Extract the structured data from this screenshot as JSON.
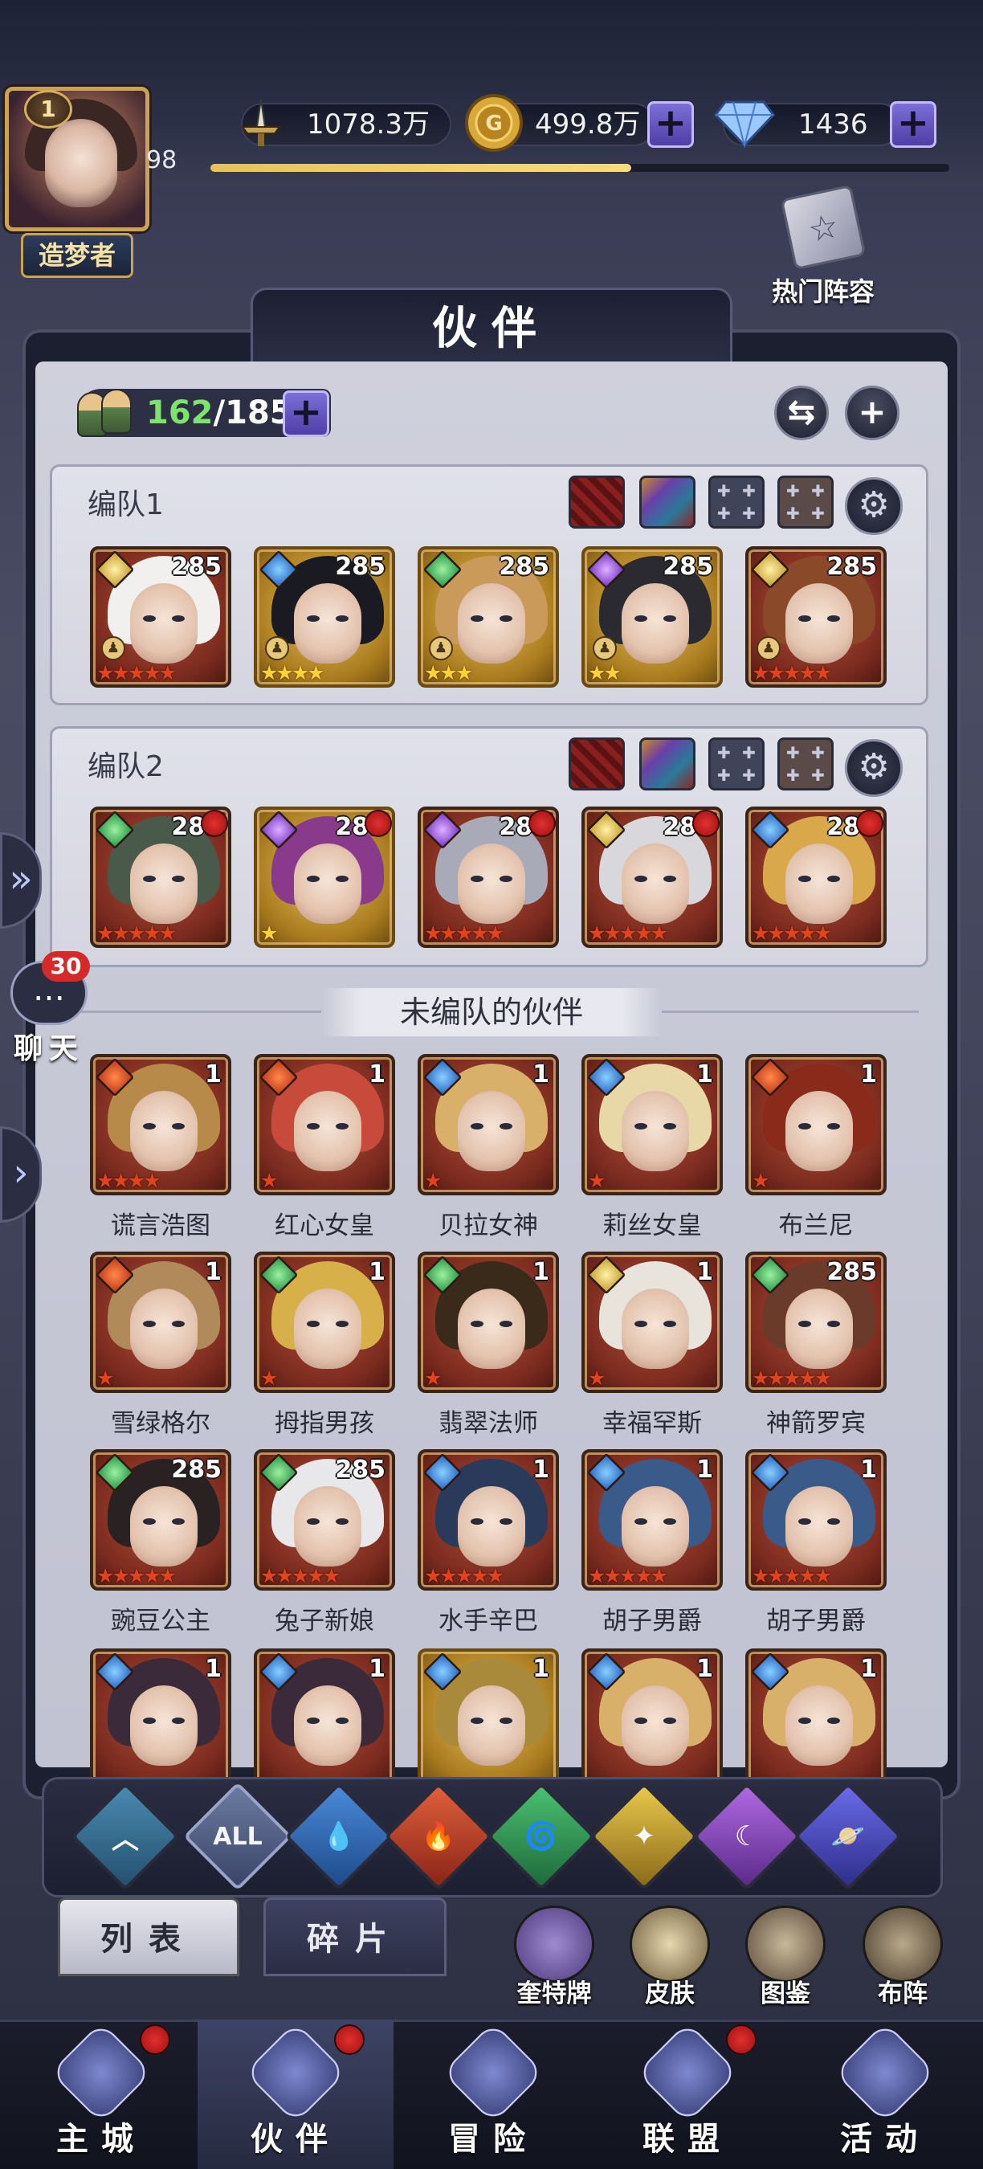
{
  "player": {
    "level": "1",
    "sub_level": "98",
    "title": "造梦者",
    "exp_fraction": 0.57
  },
  "resources": {
    "power": "1078.3万",
    "gold": "499.8万",
    "diamonds": "1436"
  },
  "hot_lineup_label": "热门阵容",
  "page_title": "伙伴",
  "partner_count": {
    "current": "162",
    "max": "/185"
  },
  "squads": [
    {
      "name": "编队1",
      "heroes": [
        {
          "level": "285",
          "element": "light",
          "bg": "red",
          "stars": "★★★★★",
          "star_color": "red",
          "hair": "#f2f0ee",
          "pawn": true,
          "dot": false
        },
        {
          "level": "285",
          "element": "water",
          "bg": "gold",
          "stars": "★★★★",
          "star_color": "gold",
          "hair": "#1a1a22",
          "pawn": true,
          "dot": false
        },
        {
          "level": "285",
          "element": "wind",
          "bg": "gold",
          "stars": "★★★",
          "star_color": "gold",
          "hair": "#c99a5a",
          "pawn": true,
          "dot": false
        },
        {
          "level": "285",
          "element": "dark",
          "bg": "gold",
          "stars": "★★",
          "star_color": "gold",
          "hair": "#2a2a30",
          "pawn": true,
          "dot": false
        },
        {
          "level": "285",
          "element": "light",
          "bg": "red",
          "stars": "★★★★★",
          "star_color": "red",
          "hair": "#8a4a2a",
          "pawn": true,
          "dot": false
        }
      ]
    },
    {
      "name": "编队2",
      "heroes": [
        {
          "level": "285",
          "element": "wind",
          "bg": "red",
          "stars": "★★★★★",
          "star_color": "red",
          "hair": "#4a5a4a",
          "pawn": false,
          "dot": true
        },
        {
          "level": "285",
          "element": "dark",
          "bg": "gold",
          "stars": "★",
          "star_color": "gold",
          "hair": "#8a3a8a",
          "pawn": false,
          "dot": true
        },
        {
          "level": "285",
          "element": "dark",
          "bg": "red",
          "stars": "★★★★★",
          "star_color": "red",
          "hair": "#a8aab8",
          "pawn": false,
          "dot": true
        },
        {
          "level": "285",
          "element": "light",
          "bg": "red",
          "stars": "★★★★★",
          "star_color": "red",
          "hair": "#d8d8dc",
          "pawn": false,
          "dot": true
        },
        {
          "level": "285",
          "element": "water",
          "bg": "red",
          "stars": "★★★★★",
          "star_color": "red",
          "hair": "#d8a84a",
          "pawn": false,
          "dot": true
        }
      ]
    }
  ],
  "unassigned_label": "未编队的伙伴",
  "unassigned": [
    {
      "name": "谎言浩图",
      "level": "1",
      "element": "fire",
      "stars": "★★★★",
      "hair": "#b88a4a"
    },
    {
      "name": "红心女皇",
      "level": "1",
      "element": "fire",
      "stars": "★",
      "hair": "#c84a3a"
    },
    {
      "name": "贝拉女神",
      "level": "1",
      "element": "water",
      "stars": "★",
      "hair": "#d8b06a"
    },
    {
      "name": "莉丝女皇",
      "level": "1",
      "element": "water",
      "stars": "★",
      "hair": "#e8d8a8"
    },
    {
      "name": "布兰尼",
      "level": "1",
      "element": "fire",
      "stars": "★",
      "hair": "#8a2a1a"
    },
    {
      "name": "雪绿格尔",
      "level": "1",
      "element": "fire",
      "stars": "★",
      "hair": "#b08a5a"
    },
    {
      "name": "拇指男孩",
      "level": "1",
      "element": "wind",
      "stars": "★",
      "hair": "#d8b04a"
    },
    {
      "name": "翡翠法师",
      "level": "1",
      "element": "wind",
      "stars": "★",
      "hair": "#3a2a1a"
    },
    {
      "name": "幸福罕斯",
      "level": "1",
      "element": "light",
      "stars": "★",
      "hair": "#e8e4dc"
    },
    {
      "name": "神箭罗宾",
      "level": "285",
      "element": "wind",
      "stars": "★★★★★",
      "hair": "#6a3a2a"
    },
    {
      "name": "豌豆公主",
      "level": "285",
      "element": "wind",
      "stars": "★★★★★",
      "hair": "#2a2222"
    },
    {
      "name": "兔子新娘",
      "level": "285",
      "element": "wind",
      "stars": "★★★★★",
      "hair": "#e8e8ea"
    },
    {
      "name": "水手辛巴",
      "level": "1",
      "element": "water",
      "stars": "★★★★★",
      "hair": "#2a3a5a"
    },
    {
      "name": "胡子男爵",
      "level": "1",
      "element": "water",
      "stars": "★★★★★",
      "hair": "#3a5a8a"
    },
    {
      "name": "胡子男爵",
      "level": "1",
      "element": "water",
      "stars": "★★★★★",
      "hair": "#3a5a8a"
    },
    {
      "name": "",
      "level": "1",
      "element": "water",
      "stars": "",
      "hair": "#3a2a3a"
    },
    {
      "name": "",
      "level": "1",
      "element": "water",
      "stars": "",
      "hair": "#3a2a3a"
    },
    {
      "name": "",
      "level": "1",
      "element": "water",
      "stars": "",
      "hair": "#a88a3a"
    },
    {
      "name": "",
      "level": "1",
      "element": "water",
      "stars": "",
      "hair": "#d8b06a"
    },
    {
      "name": "",
      "level": "1",
      "element": "water",
      "stars": "",
      "hair": "#d8b06a"
    }
  ],
  "filters": [
    {
      "id": "base",
      "glyph": "︿"
    },
    {
      "id": "all",
      "glyph": "ALL"
    },
    {
      "id": "water",
      "glyph": "💧"
    },
    {
      "id": "fire",
      "glyph": "🔥"
    },
    {
      "id": "wind",
      "glyph": "🌀"
    },
    {
      "id": "light",
      "glyph": "✦"
    },
    {
      "id": "dark",
      "glyph": "☾"
    },
    {
      "id": "cosmic",
      "glyph": "🪐"
    }
  ],
  "tabs": {
    "list": "列表",
    "fragments": "碎片"
  },
  "shortcuts": [
    {
      "label": "奎特牌"
    },
    {
      "label": "皮肤"
    },
    {
      "label": "图鉴"
    },
    {
      "label": "布阵"
    }
  ],
  "chat": {
    "badge": "30",
    "label": "聊天",
    "glyph": "…"
  },
  "nav": [
    {
      "label": "主城",
      "dot": true,
      "active": false
    },
    {
      "label": "伙伴",
      "dot": true,
      "active": true
    },
    {
      "label": "冒险",
      "dot": false,
      "active": false
    },
    {
      "label": "联盟",
      "dot": true,
      "active": false
    },
    {
      "label": "活动",
      "dot": false,
      "active": false
    }
  ],
  "colors": {
    "accent_purple": "#6a5ad0",
    "gold": "#c9a253",
    "count_green": "#7ee36a"
  }
}
